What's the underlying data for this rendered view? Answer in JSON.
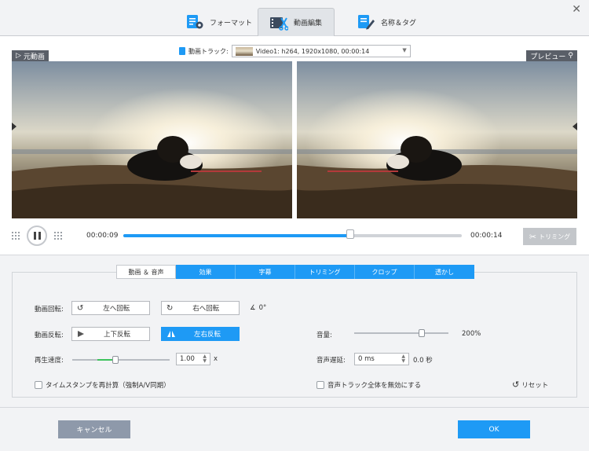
{
  "window": {
    "close_glyph": "✕"
  },
  "top_tabs": [
    {
      "label": "フォーマット",
      "icon": "format-settings-icon"
    },
    {
      "label": "動画編集",
      "icon": "video-edit-icon",
      "active": true
    },
    {
      "label": "名称＆タグ",
      "icon": "rename-tag-icon"
    }
  ],
  "track": {
    "label": "動画トラック:",
    "value": "Video1: h264, 1920x1080, 00:00:14"
  },
  "original_label": "元動画",
  "preview_label": "プレビュー",
  "playback": {
    "current_time": "00:00:09",
    "total_time": "00:00:14",
    "progress_fraction": 0.67
  },
  "trim_button": {
    "label": "トリミング"
  },
  "edit_tabs": [
    {
      "label": "動画 ＆ 音声",
      "active": true
    },
    {
      "label": "効果"
    },
    {
      "label": "字幕"
    },
    {
      "label": "トリミング"
    },
    {
      "label": "クロップ"
    },
    {
      "label": "透かし"
    }
  ],
  "rotate": {
    "label": "動画回転:",
    "left_label": "左へ回転",
    "right_label": "右へ回転",
    "angle": "0°"
  },
  "flip": {
    "label": "動画反転:",
    "vertical_label": "上下反転",
    "horizontal_label": "左右反転"
  },
  "speed": {
    "label": "再生速度:",
    "value": "1.00",
    "unit": "x",
    "slider_fraction": 0.44
  },
  "timestamp_checkbox": {
    "label": "タイムスタンプを再計算（強制A/V同期）",
    "checked": false
  },
  "volume": {
    "label": "音量:",
    "value": "200%",
    "slider_fraction": 0.72
  },
  "audio_delay": {
    "label": "音声遅延:",
    "value": "0 ms",
    "readout": "0.0 秒"
  },
  "mute_checkbox": {
    "label": "音声トラック全体を無効にする",
    "checked": false
  },
  "reset_button": {
    "label": "リセット"
  },
  "footer": {
    "cancel_label": "キャンセル",
    "ok_label": "OK"
  },
  "colors": {
    "accent": "#1e9af5",
    "cancel": "#8e99aa",
    "trim_disabled": "#c3c6ca"
  }
}
